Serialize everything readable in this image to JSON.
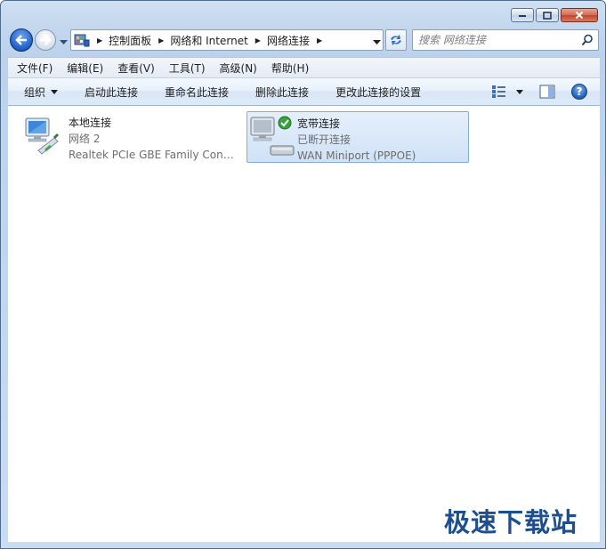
{
  "window": {
    "caption_buttons": [
      "minimize",
      "maximize",
      "close"
    ]
  },
  "address": {
    "breadcrumbs": [
      {
        "label": "控制面板"
      },
      {
        "label": "网络和 Internet"
      },
      {
        "label": "网络连接"
      }
    ]
  },
  "search": {
    "placeholder": "搜索 网络连接"
  },
  "menu": {
    "items": [
      {
        "label": "文件(F)"
      },
      {
        "label": "编辑(E)"
      },
      {
        "label": "查看(V)"
      },
      {
        "label": "工具(T)"
      },
      {
        "label": "高级(N)"
      },
      {
        "label": "帮助(H)"
      }
    ]
  },
  "commands": {
    "organize": "组织",
    "enable": "启动此连接",
    "rename": "重命名此连接",
    "delete": "删除此连接",
    "change": "更改此连接的设置",
    "help": "?"
  },
  "connections": [
    {
      "name": "本地连接",
      "status": "网络  2",
      "device": "Realtek PCIe GBE Family Controller",
      "icon": "lan-icon",
      "selected": false
    },
    {
      "name": "宽带连接",
      "status": "已断开连接",
      "device": "WAN Miniport (PPPOE)",
      "icon": "broadband-icon",
      "selected": true
    }
  ],
  "watermark": "极速下载站",
  "colors": {
    "selection": "#d0e2f7",
    "selection_border": "#84acdd",
    "watermark": "#1d4f8f"
  }
}
